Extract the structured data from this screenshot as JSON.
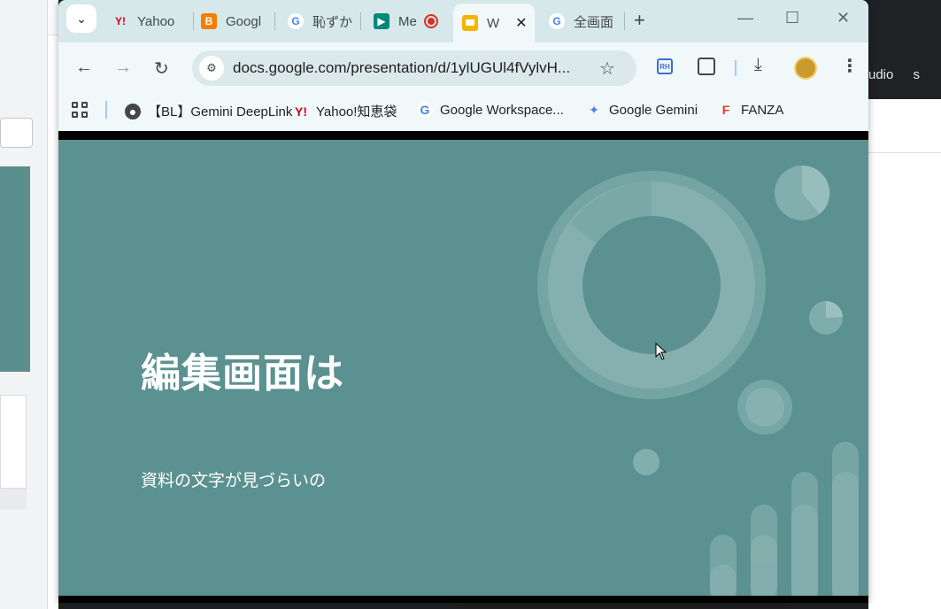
{
  "tabs": [
    {
      "label": "Yahoo",
      "icon": "yahoo-icon",
      "icon_glyph": "Y!"
    },
    {
      "label": "Googl",
      "icon": "blogger-icon",
      "icon_glyph": "B"
    },
    {
      "label": "恥ずか",
      "icon": "google-icon",
      "icon_glyph": "G"
    },
    {
      "label": "Me",
      "icon": "google-meet-icon",
      "icon_glyph": "▶"
    },
    {
      "label": "W",
      "icon": "google-slides-icon",
      "icon_glyph": ""
    },
    {
      "label": "全画面",
      "icon": "google-icon",
      "icon_glyph": "G"
    }
  ],
  "window_controls": {
    "minimize": "—",
    "maximize": "☐",
    "close": "✕"
  },
  "toolbar": {
    "url": "docs.google.com/presentation/d/1ylUGUl4fVylvH...",
    "extension_label": "RH"
  },
  "bookmarks": [
    {
      "label": "【BL】Gemini DeepLink",
      "icon": "globe-icon",
      "icon_glyph": "●"
    },
    {
      "label": "Yahoo!知恵袋",
      "icon": "yahoo-icon",
      "icon_glyph": "Y!"
    },
    {
      "label": "Google Workspace...",
      "icon": "google-icon",
      "icon_glyph": "G"
    },
    {
      "label": "Google Gemini",
      "icon": "gemini-icon",
      "icon_glyph": "✦"
    },
    {
      "label": "FANZA",
      "icon": "fanza-icon",
      "icon_glyph": "F"
    }
  ],
  "slide": {
    "title": "編集画面は",
    "subtitle": "資料の文字が見づらいの"
  },
  "background_window": {
    "right_text": "udio",
    "right_text2": "s"
  },
  "colors": {
    "slide_bg": "#5b9190",
    "tab_strip": "#d6e8ea",
    "toolbar": "#f1f8f9"
  }
}
